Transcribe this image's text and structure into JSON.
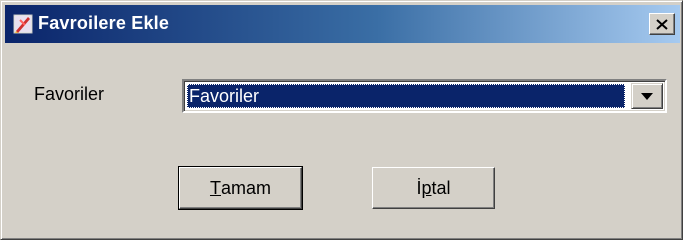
{
  "window": {
    "title": "Favroilere Ekle",
    "icon": "favorites-app-icon",
    "close_icon": "close-icon"
  },
  "form": {
    "label": "Favoriler",
    "combo": {
      "selected_value": "Favoriler",
      "arrow_icon": "dropdown-arrow-icon"
    }
  },
  "buttons": {
    "ok": {
      "mnemonic": "T",
      "rest": "amam"
    },
    "cancel": {
      "pre": "İ",
      "mnemonic": "p",
      "rest": "tal"
    }
  },
  "colors": {
    "titlebar_start": "#0a246a",
    "titlebar_end": "#a6caf0",
    "face": "#d4d0c8",
    "selection": "#0a246a"
  }
}
